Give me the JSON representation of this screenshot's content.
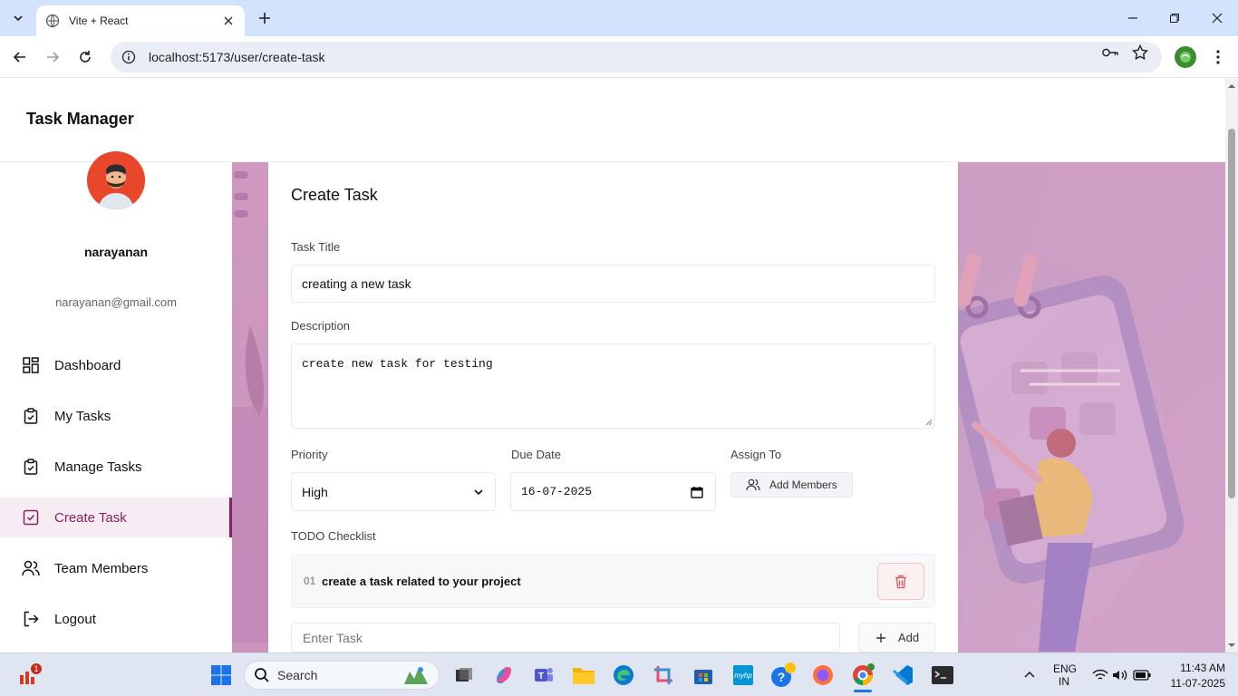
{
  "browser": {
    "tab_title": "Vite + React",
    "url": "localhost:5173/user/create-task"
  },
  "app": {
    "title": "Task Manager"
  },
  "user": {
    "name": "narayanan",
    "email": "narayanan@gmail.com"
  },
  "sidebar": {
    "items": [
      {
        "label": "Dashboard",
        "icon": "dashboard-icon"
      },
      {
        "label": "My Tasks",
        "icon": "clipboard-check-icon"
      },
      {
        "label": "Manage Tasks",
        "icon": "clipboard-check-icon"
      },
      {
        "label": "Create Task",
        "icon": "square-check-icon",
        "active": true
      },
      {
        "label": "Team Members",
        "icon": "users-icon"
      },
      {
        "label": "Logout",
        "icon": "logout-icon"
      }
    ]
  },
  "form": {
    "heading": "Create Task",
    "task_title_label": "Task Title",
    "task_title_value": "creating a new task",
    "description_label": "Description",
    "description_value": "create new task for testing",
    "priority_label": "Priority",
    "priority_value": "High",
    "due_date_label": "Due Date",
    "due_date_value": "16-07-2025",
    "assign_label": "Assign To",
    "add_members_label": "Add Members",
    "checklist_label": "TODO Checklist",
    "checklist": [
      {
        "num": "01",
        "text": "create a task related to your project"
      }
    ],
    "enter_task_placeholder": "Enter Task",
    "add_label": "Add"
  },
  "taskbar": {
    "search_label": "Search",
    "notification_count": "1",
    "lang": "ENG",
    "region": "IN",
    "time": "11:43 AM",
    "date": "11-07-2025"
  },
  "colors": {
    "accent": "#8a2060",
    "chrome_tab_bar": "#d3e3fd",
    "delete_red": "#e05252"
  }
}
